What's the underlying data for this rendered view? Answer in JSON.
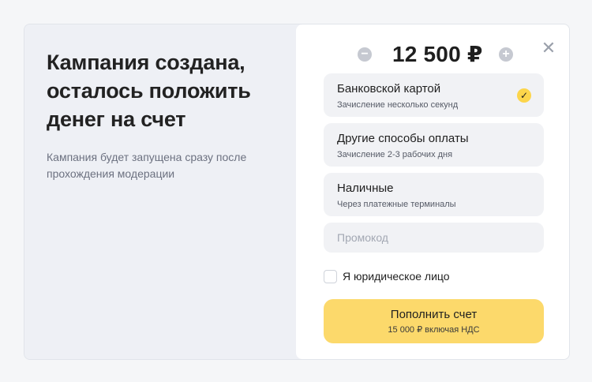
{
  "left": {
    "title": "Кампания создана, осталось положить денег на счет",
    "subtitle": "Кампания будет запущена сразу после прохождения модерации"
  },
  "amount": {
    "value": "12 500 ₽",
    "minus_icon": "minus-icon",
    "plus_icon": "plus-icon"
  },
  "close_icon": "close-icon",
  "options": [
    {
      "title": "Банковской картой",
      "subtitle": "Зачисление несколько секунд",
      "selected": true
    },
    {
      "title": "Другие способы оплаты",
      "subtitle": "Зачисление 2-3 рабочих дня",
      "selected": false
    },
    {
      "title": "Наличные",
      "subtitle": "Через платежные терминалы",
      "selected": false
    }
  ],
  "promo": {
    "placeholder": "Промокод",
    "value": ""
  },
  "legal_checkbox": {
    "label": "Я юридическое лицо",
    "checked": false
  },
  "pay_button": {
    "label": "Пополнить счет",
    "sublabel": "15 000 ₽ включая НДС"
  },
  "colors": {
    "accent": "#fcd96b",
    "check": "#fcd54b",
    "option_bg": "#f1f2f5",
    "left_bg": "#eef0f5"
  }
}
